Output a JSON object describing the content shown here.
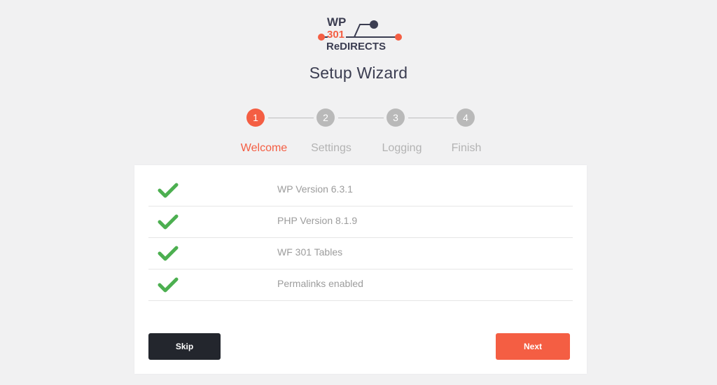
{
  "logo": {
    "line1": "WP",
    "line2": "301",
    "line3": "ReDIRECTS",
    "colors": {
      "dark": "#3b3d51",
      "accent": "#f45e43"
    }
  },
  "wizard": {
    "title": "Setup Wizard",
    "steps": [
      {
        "number": "1",
        "label": "Welcome",
        "active": true
      },
      {
        "number": "2",
        "label": "Settings",
        "active": false
      },
      {
        "number": "3",
        "label": "Logging",
        "active": false
      },
      {
        "number": "4",
        "label": "Finish",
        "active": false
      }
    ]
  },
  "checks": [
    {
      "icon": "checkmark-icon",
      "label": "WP Version 6.3.1"
    },
    {
      "icon": "checkmark-icon",
      "label": "PHP Version 8.1.9"
    },
    {
      "icon": "checkmark-icon",
      "label": "WF 301 Tables"
    },
    {
      "icon": "checkmark-icon",
      "label": "Permalinks enabled"
    }
  ],
  "buttons": {
    "skip": "Skip",
    "next": "Next"
  },
  "colors": {
    "accent": "#f45e43",
    "inactive": "#b9b9b9",
    "success": "#4caf50",
    "dark_button": "#23262d"
  }
}
